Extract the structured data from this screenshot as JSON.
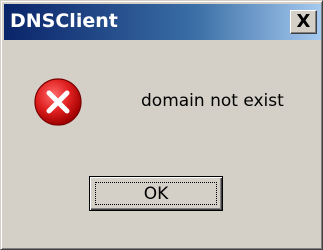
{
  "window": {
    "title": "DNSClient",
    "close_glyph": "X"
  },
  "dialog": {
    "icon": "error-icon",
    "message": "domain not exist",
    "ok_label": "OK"
  },
  "colors": {
    "title_gradient_start": "#0a246a",
    "title_gradient_end": "#a6caf0",
    "dialog_face": "#d4d0c8",
    "error_red": "#e02020"
  }
}
